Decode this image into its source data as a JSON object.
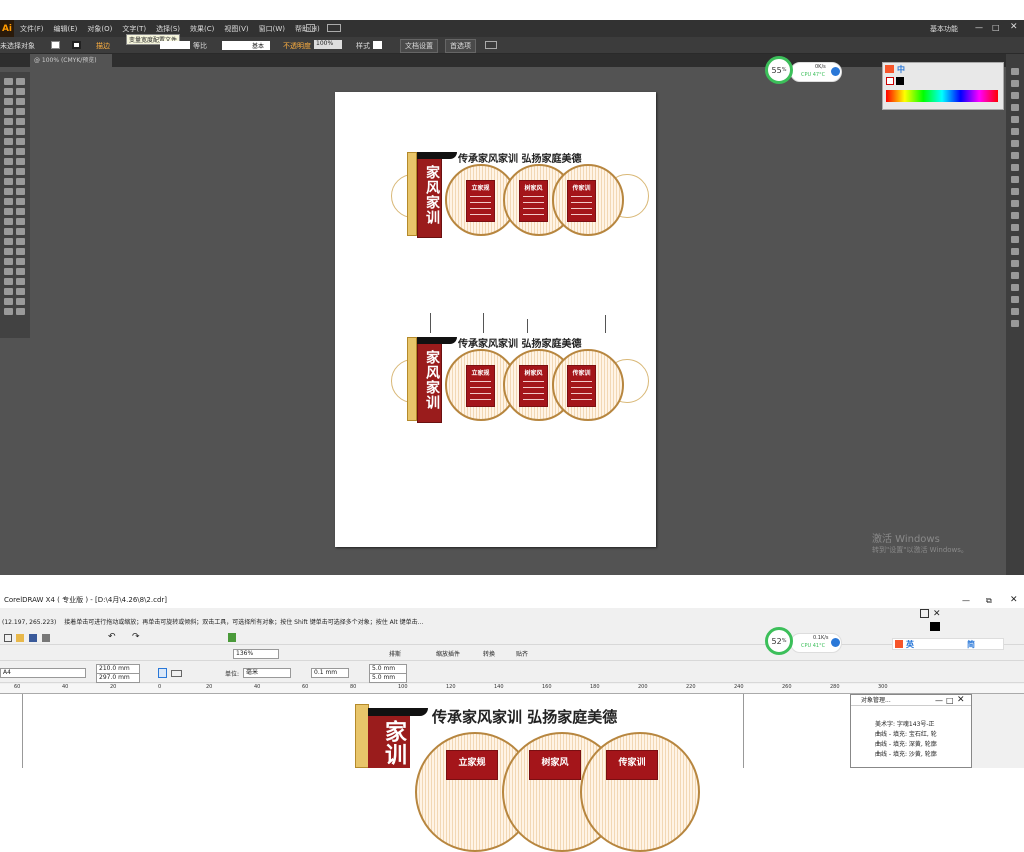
{
  "ai": {
    "logo": "Ai",
    "menus": [
      "文件(F)",
      "编辑(E)",
      "对象(O)",
      "文字(T)",
      "选择(S)",
      "效果(C)",
      "视图(V)",
      "窗口(W)",
      "帮助(H)"
    ],
    "workspace": "基本功能",
    "ctrl": {
      "no_selection": "未选择对象",
      "stroke_label": "描边",
      "tooltip": "变量宽度配置文件",
      "proportion": "等比",
      "stroke_style": "基本",
      "opacity_label": "不透明度",
      "opacity": "100%",
      "style_label": "样式",
      "doc_setup": "文档设置",
      "prefs": "首选项"
    },
    "tab": "@ 100% (CMYK/预览)",
    "activate_title": "激活 Windows",
    "activate_sub": "转到\"设置\"以激活 Windows。"
  },
  "monitor_top": {
    "percent": "55",
    "unit": "%",
    "net": "0K/s",
    "cpu": "CPU 47°C"
  },
  "monitor_bottom": {
    "percent": "52",
    "unit": "%",
    "net": "0.1K/s",
    "cpu": "CPU 41°C"
  },
  "ime_top": {
    "mode": "中"
  },
  "ime_bottom": {
    "mode": "英",
    "simp": "简"
  },
  "design": {
    "headline": "传承家风家训  弘扬家庭美德",
    "banner": "家风家训",
    "boards": [
      "立家规",
      "树家风",
      "传家训"
    ]
  },
  "cdr": {
    "title": "CorelDRAW X4 ( 专业版 ) - [D:\\4月\\4.26\\8\\2.cdr]",
    "coords": "(12.197, 265.223)",
    "status": "接着单击可进行拖动或缩放；再单击可旋转或倾斜；双击工具，可选择所有对象；按住 Shift 键单击可选择多个对象；按住 Alt 键单击...",
    "page_size": "A4",
    "width": "210.0 mm",
    "height": "297.0 mm",
    "zoom": "136%",
    "unit_label": "单位:",
    "unit": "毫米",
    "nudge": "0.1 mm",
    "dup_x": "5.0 mm",
    "dup_y": "5.0 mm",
    "tool_labels": [
      "排斯",
      "缩放插件",
      "转换",
      "贴齐"
    ],
    "ruler": [
      "60",
      "40",
      "20",
      "0",
      "20",
      "40",
      "60",
      "80",
      "100",
      "120",
      "140",
      "160",
      "180",
      "200",
      "220",
      "240",
      "260",
      "280",
      "300"
    ],
    "obj_manager": "对象管理...",
    "obj_items": [
      "美术字: 字魂143号-正",
      "曲线 - 填充: 宝石红, 轮",
      "曲线 - 填充: 深黄, 轮廓",
      "曲线 - 填充: 沙黄, 轮廓"
    ]
  }
}
